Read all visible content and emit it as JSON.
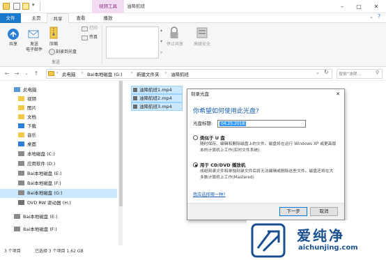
{
  "window": {
    "context_tab": "视频工具",
    "title": "油降航班",
    "tabs": [
      "文件",
      "主页",
      "共享",
      "查看",
      "播放"
    ],
    "active_tab": "共享"
  },
  "ribbon": {
    "share_label": "共享",
    "email_label": "发送\n电子邮件",
    "zip_label": "压缩",
    "burn_label": "刻录到光盘",
    "print_label": "打印",
    "fax_label": "传真",
    "send_group": "发送",
    "stop_share_label": "停止共享",
    "adv_security_label": "高级安全"
  },
  "address": {
    "breadcrumb": [
      "此电脑",
      "Bai本地磁盘 (G:)",
      "新建文件夹",
      "油降航班"
    ],
    "search_placeholder": "搜索\"油降..."
  },
  "nav": {
    "items": [
      {
        "label": "此电脑",
        "icon": "computer-icon"
      },
      {
        "label": "视频",
        "icon": "video-folder-icon"
      },
      {
        "label": "图片",
        "icon": "pictures-folder-icon"
      },
      {
        "label": "文档",
        "icon": "documents-folder-icon"
      },
      {
        "label": "下载",
        "icon": "downloads-folder-icon"
      },
      {
        "label": "音乐",
        "icon": "music-folder-icon"
      },
      {
        "label": "桌面",
        "icon": "desktop-folder-icon"
      },
      {
        "label": "本地磁盘 (C:)",
        "icon": "drive-icon"
      },
      {
        "label": "应用软件 (D:)",
        "icon": "drive-icon"
      },
      {
        "label": "Bai本地磁盘 (E:)",
        "icon": "drive-icon"
      },
      {
        "label": "Bai本地磁盘 (F:)",
        "icon": "drive-icon"
      },
      {
        "label": "Bai本地磁盘 (G:)",
        "icon": "drive-icon"
      },
      {
        "label": "DVD RW 驱动器 (H:)",
        "icon": "dvd-drive-icon"
      },
      {
        "label": "Bai本地磁盘 (E:)",
        "icon": "drive-icon"
      },
      {
        "label": "Bai本地磁盘 (F:)",
        "icon": "drive-icon"
      }
    ],
    "selected_index": 11
  },
  "files": [
    "油降航班1.mp4",
    "油降航班2.mp4",
    "油降航班3.mp4"
  ],
  "status": {
    "count": "3 个项目",
    "selected": "已选择 3 个项目  1.62 GB"
  },
  "dialog": {
    "title": "刻录光盘",
    "close": "✕",
    "heading": "你希望如何使用此光盘?",
    "disc_title_label": "光盘标题:",
    "disc_title_value": "04.25.2018",
    "option1_title": "类似于 U 盘",
    "option1_desc": "随时保存、编辑和删除磁盘上的文件。磁盘将在运行 Windows XP 或更高版本的计算机上工作(实时文件系统)",
    "option2_title": "用于 CD/DVD 播放机",
    "option2_desc": "成组刻录文件和单独刻录文件后将无法编辑或删除这些文件。磁盘还将在大多数计算机上工作(Mastered)",
    "link": "我应选择哪一种?",
    "next_button": "下一步",
    "cancel_button": "取消"
  },
  "watermark": {
    "brand": "爱纯净",
    "url": "aichunjing.com"
  },
  "colors": {
    "accent": "#1979ca",
    "context_tab_bg": "#f2dcf1",
    "selection": "#cce8ff",
    "link": "#1a5fb4"
  }
}
